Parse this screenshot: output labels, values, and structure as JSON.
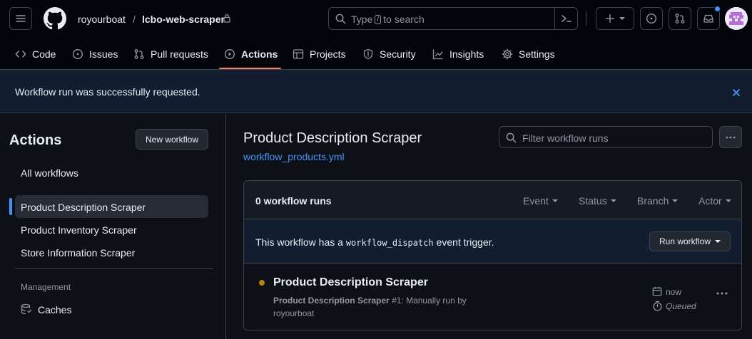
{
  "header": {
    "owner": "royourboat",
    "separator": "/",
    "repo": "lcbo-web-scraper",
    "search_prefix": "Type",
    "search_key": "/",
    "search_suffix": "to search"
  },
  "nav": {
    "tabs": [
      {
        "label": "Code",
        "icon": "code-icon"
      },
      {
        "label": "Issues",
        "icon": "issue-icon"
      },
      {
        "label": "Pull requests",
        "icon": "pull-request-icon"
      },
      {
        "label": "Actions",
        "icon": "play-icon",
        "selected": true
      },
      {
        "label": "Projects",
        "icon": "table-icon"
      },
      {
        "label": "Security",
        "icon": "shield-icon"
      },
      {
        "label": "Insights",
        "icon": "graph-icon"
      },
      {
        "label": "Settings",
        "icon": "gear-icon"
      }
    ]
  },
  "flash": {
    "message": "Workflow run was successfully requested."
  },
  "sidebar": {
    "title": "Actions",
    "new_workflow_label": "New workflow",
    "all_workflows": "All workflows",
    "workflows": [
      {
        "label": "Product Description Scraper",
        "selected": true
      },
      {
        "label": "Product Inventory Scraper"
      },
      {
        "label": "Store Information Scraper"
      }
    ],
    "management_heading": "Management",
    "caches_label": "Caches"
  },
  "main": {
    "workflow_title": "Product Description Scraper",
    "workflow_file": "workflow_products.yml",
    "filter_placeholder": "Filter workflow runs",
    "runs_count": "0 workflow runs",
    "filters": [
      "Event",
      "Status",
      "Branch",
      "Actor"
    ],
    "dispatch_prefix": "This workflow has a",
    "dispatch_code": "workflow_dispatch",
    "dispatch_suffix": "event trigger.",
    "run_workflow_label": "Run workflow",
    "run": {
      "title": "Product Description Scraper",
      "subtitle_bold": "Product Description Scraper",
      "subtitle_rest": "#1: Manually run by royourboat",
      "time": "now",
      "status": "Queued"
    }
  },
  "colors": {
    "accent_blue": "#4493f8",
    "tab_underline": "#f78166",
    "queued_dot": "#bb8009"
  }
}
